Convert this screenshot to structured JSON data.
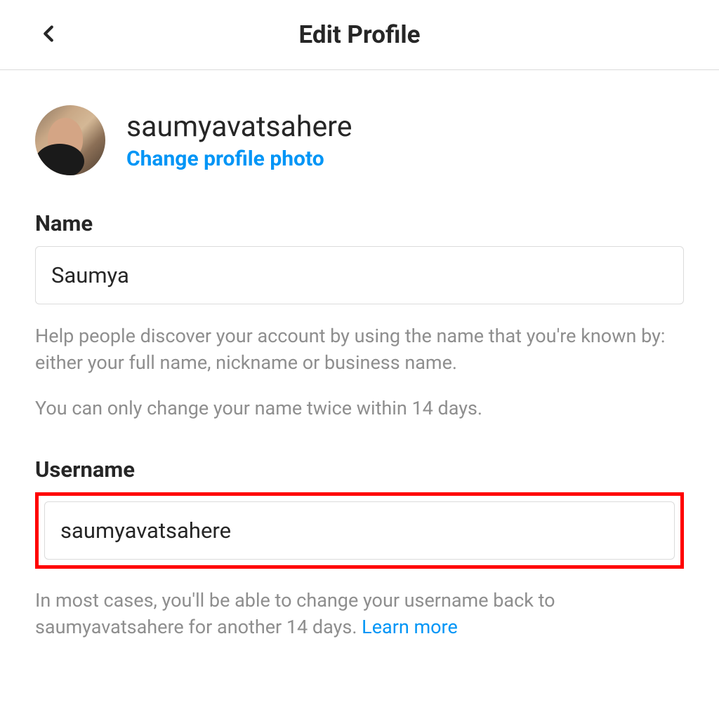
{
  "header": {
    "title": "Edit Profile"
  },
  "profile": {
    "username_display": "saumyavatsahere",
    "change_photo_label": "Change profile photo"
  },
  "name_field": {
    "label": "Name",
    "value": "Saumya",
    "help_text_1": "Help people discover your account by using the name that you're known by: either your full name, nickname or business name.",
    "help_text_2": "You can only change your name twice within 14 days."
  },
  "username_field": {
    "label": "Username",
    "value": "saumyavatsahere",
    "help_text_prefix": "In most cases, you'll be able to change your username back to saumyavatsahere for another 14 days. ",
    "learn_more_label": "Learn more"
  }
}
